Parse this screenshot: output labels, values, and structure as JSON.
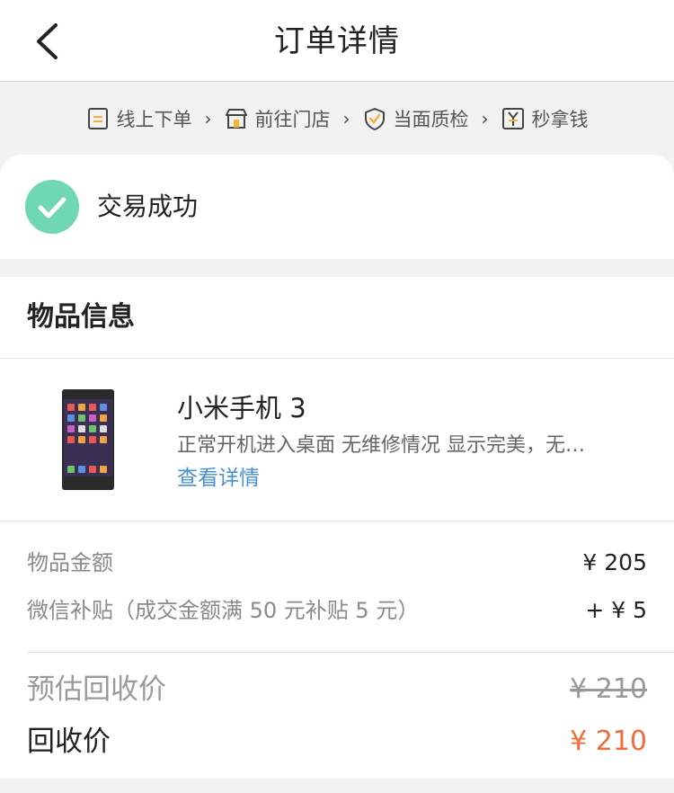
{
  "nav": {
    "title": "订单详情"
  },
  "steps": [
    {
      "label": "线上下单",
      "icon": "document-icon"
    },
    {
      "label": "前往门店",
      "icon": "store-icon"
    },
    {
      "label": "当面质检",
      "icon": "shield-check-icon"
    },
    {
      "label": "秒拿钱",
      "icon": "yuan-icon"
    }
  ],
  "status": {
    "text": "交易成功",
    "color": "#6fd7b1"
  },
  "item_section": {
    "title": "物品信息",
    "product": {
      "name": "小米手机 3",
      "description": "正常开机进入桌面 无维修情况 显示完美，无…",
      "detail_link": "查看详情"
    }
  },
  "pricing": {
    "item_amount_label": "物品金额",
    "item_amount_value": "¥ 205",
    "subsidy_label": "微信补贴（成交金额满 50 元补贴 5 元）",
    "subsidy_value": "+ ¥ 5",
    "estimated_label": "预估回收价",
    "estimated_value": "¥ 210",
    "final_label": "回收价",
    "final_value": "¥ 210"
  },
  "colors": {
    "accent_orange": "#f26b3a",
    "link_blue": "#4a8fd0",
    "icon_orange": "#f4b23a"
  }
}
